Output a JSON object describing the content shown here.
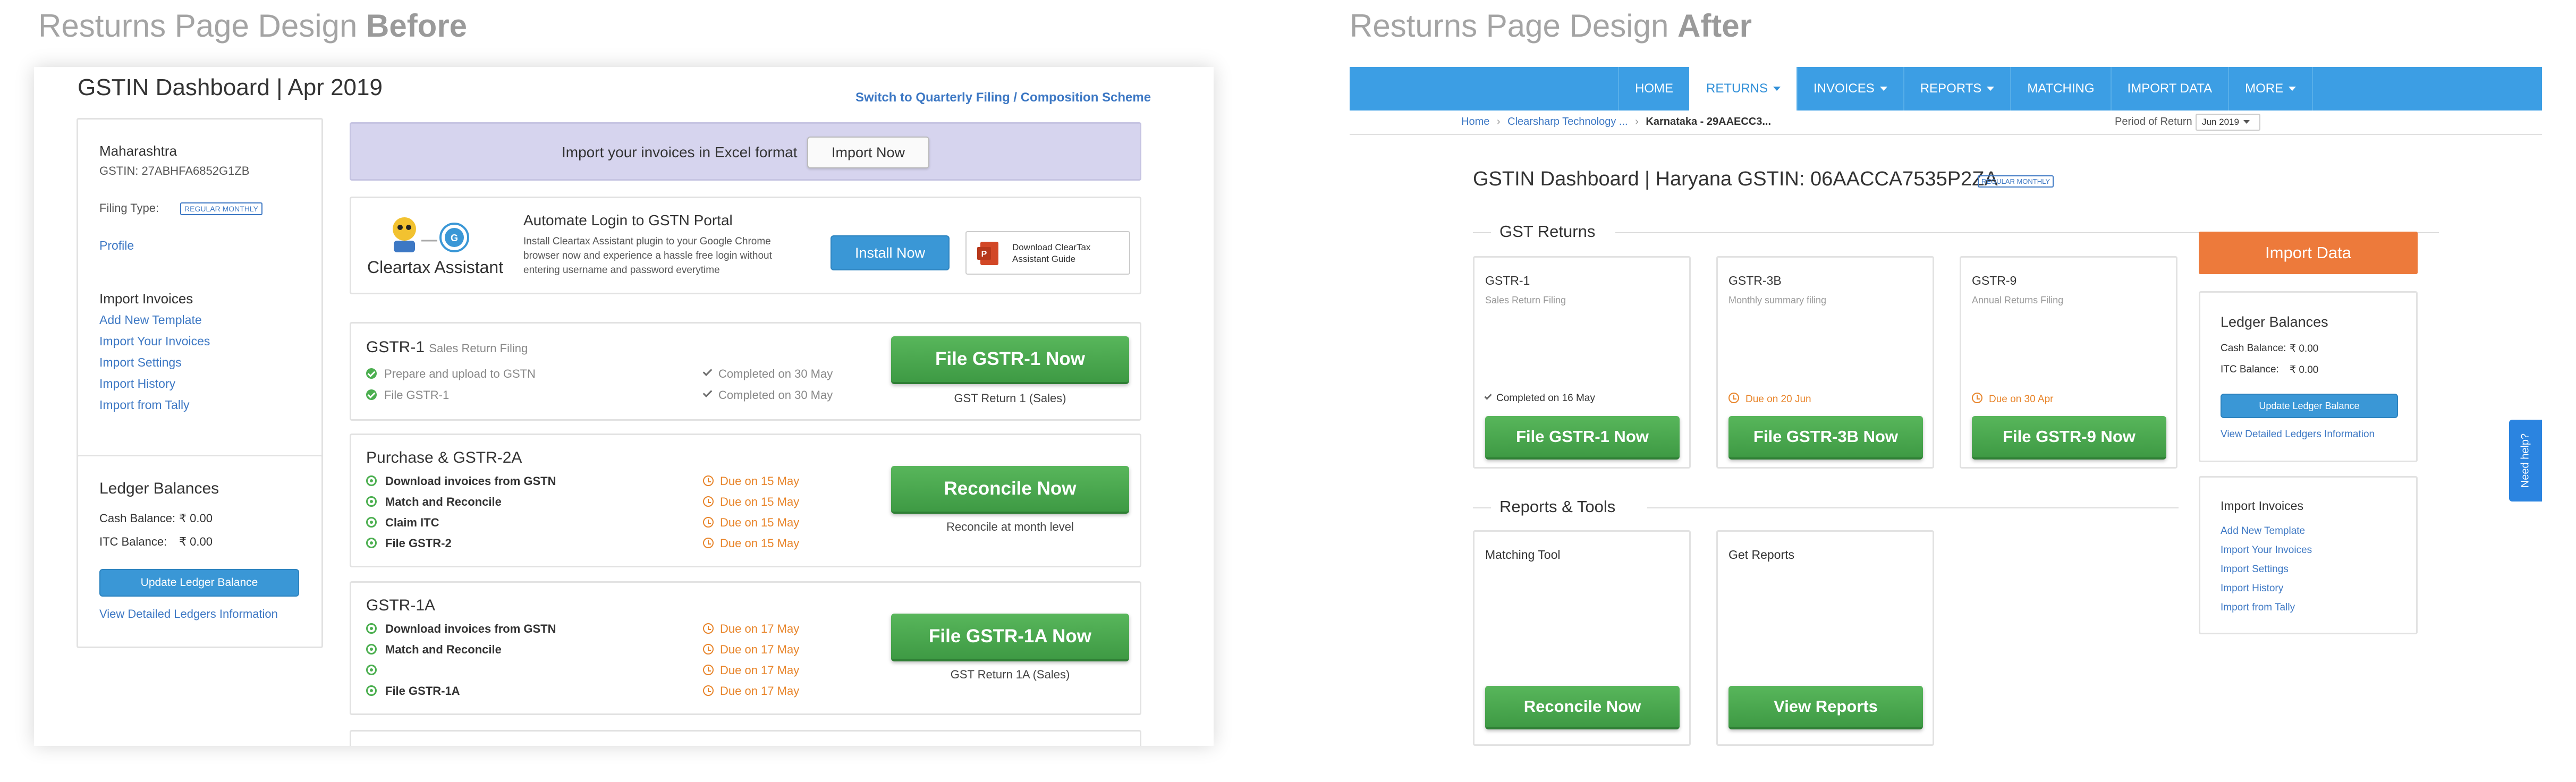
{
  "page_titles": {
    "before_prefix": "Resturns Page Design ",
    "before_bold": "Before",
    "after_prefix": "Resturns Page Design ",
    "after_bold": "After"
  },
  "before": {
    "title": "GSTIN Dashboard | Apr 2019",
    "switch_link": "Switch to Quarterly Filing / Composition Scheme",
    "profile": {
      "state": "Maharashtra",
      "gstin": "GSTIN: 27ABHFA6852G1ZB",
      "filing_label": "Filing Type:",
      "filing_badge": "REGULAR MONTHLY",
      "profile_link": "Profile",
      "import_heading": "Import Invoices",
      "links": [
        "Add New Template",
        "Import Your Invoices",
        "Import Settings",
        "Import History",
        "Import from Tally"
      ]
    },
    "ledger": {
      "heading": "Ledger Balances",
      "cash_label": "Cash Balance:",
      "cash_value": "₹ 0.00",
      "itc_label": "ITC Balance:",
      "itc_value": "₹ 0.00",
      "update_button": "Update Ledger Balance",
      "view_link": "View Detailed Ledgers Information"
    },
    "import_banner": {
      "text": "Import your invoices in Excel format",
      "button": "Import Now"
    },
    "assistant": {
      "brand": "Cleartax Assistant",
      "heading": "Automate Login to GSTN Portal",
      "body": "Install Cleartax Assistant plugin to your Google Chrome browser now and experience a hassle free login without entering username and password everytime",
      "install_button": "Install Now",
      "guide_button": "Download ClearTax Assistant Guide"
    },
    "gstr1": {
      "title": "GSTR-1",
      "subtitle": "Sales Return Filing",
      "tasks": [
        {
          "label": "Prepare and upload to GSTN",
          "status": "Completed on 30 May"
        },
        {
          "label": "File GSTR-1",
          "status": "Completed on 30 May"
        }
      ],
      "button": "File GSTR-1 Now",
      "caption": "GST Return 1 (Sales)"
    },
    "gstr2a": {
      "title": "Purchase & GSTR-2A",
      "tasks": [
        {
          "label": "Download invoices from GSTN",
          "status": "Due on 15 May"
        },
        {
          "label": "Match and Reconcile",
          "status": "Due on 15 May"
        },
        {
          "label": "Claim ITC",
          "status": "Due on 15 May"
        },
        {
          "label": "File GSTR-2",
          "status": "Due on 15 May"
        }
      ],
      "button": "Reconcile Now",
      "caption": "Reconcile at month level"
    },
    "gstr1a": {
      "title": "GSTR-1A",
      "tasks": [
        {
          "label": "Download invoices from GSTN",
          "status": "Due on 17 May"
        },
        {
          "label": "Match and Reconcile",
          "status": "Due on 17 May"
        },
        {
          "label": "",
          "status": "Due on 17 May"
        },
        {
          "label": "File GSTR-1A",
          "status": "Due on 17 May"
        }
      ],
      "button": "File GSTR-1A Now",
      "caption": "GST Return 1A (Sales)"
    }
  },
  "after": {
    "nav": [
      {
        "label": "HOME",
        "dropdown": false
      },
      {
        "label": "RETURNS",
        "dropdown": true
      },
      {
        "label": "INVOICES",
        "dropdown": true
      },
      {
        "label": "REPORTS",
        "dropdown": true
      },
      {
        "label": "MATCHING",
        "dropdown": false
      },
      {
        "label": "IMPORT DATA",
        "dropdown": false
      },
      {
        "label": "MORE",
        "dropdown": true
      }
    ],
    "breadcrumb": [
      "Home",
      "Clearsharp Technology ...",
      "Karnataka - 29AAECC3..."
    ],
    "period_label": "Period of Return",
    "period_value": "Jun 2019",
    "title": "GSTIN Dashboard | Haryana GSTIN: 06AACCA7535P2ZA",
    "badge": "REGULAR MONTHLY",
    "gst_returns_heading": "GST Returns",
    "returns": [
      {
        "title": "GSTR-1",
        "subtitle": "Sales Return Filing",
        "status": "Completed on 16 May",
        "button": "File GSTR-1 Now"
      },
      {
        "title": "GSTR-3B",
        "subtitle": "Monthly summary filing",
        "status": "Due on 20 Jun",
        "button": "File GSTR-3B Now"
      },
      {
        "title": "GSTR-9",
        "subtitle": "Annual Returns Filing",
        "status": "Due on 30 Apr",
        "button": "File GSTR-9 Now"
      }
    ],
    "reports_heading": "Reports & Tools",
    "tools": [
      {
        "title": "Matching Tool",
        "button": "Reconcile Now"
      },
      {
        "title": "Get Reports",
        "button": "View Reports"
      }
    ],
    "import_data_button": "Import Data",
    "ledger": {
      "heading": "Ledger Balances",
      "cash_label": "Cash Balance:",
      "cash_value": "₹ 0.00",
      "itc_label": "ITC Balance:",
      "itc_value": "₹ 0.00",
      "update_button": "Update Ledger Balance",
      "view_link": "View Detailed Ledgers Information"
    },
    "import_invoices": {
      "heading": "Import Invoices",
      "links": [
        "Add New Template",
        "Import Your Invoices",
        "Import Settings",
        "Import History",
        "Import from Tally"
      ]
    },
    "need_help": "Need help?"
  },
  "colors": {
    "green": "#4caf50",
    "blue": "#3a97d6",
    "orange": "#ed7a3b",
    "nav_blue": "#3c9ee4",
    "due_orange": "#e8852b"
  }
}
